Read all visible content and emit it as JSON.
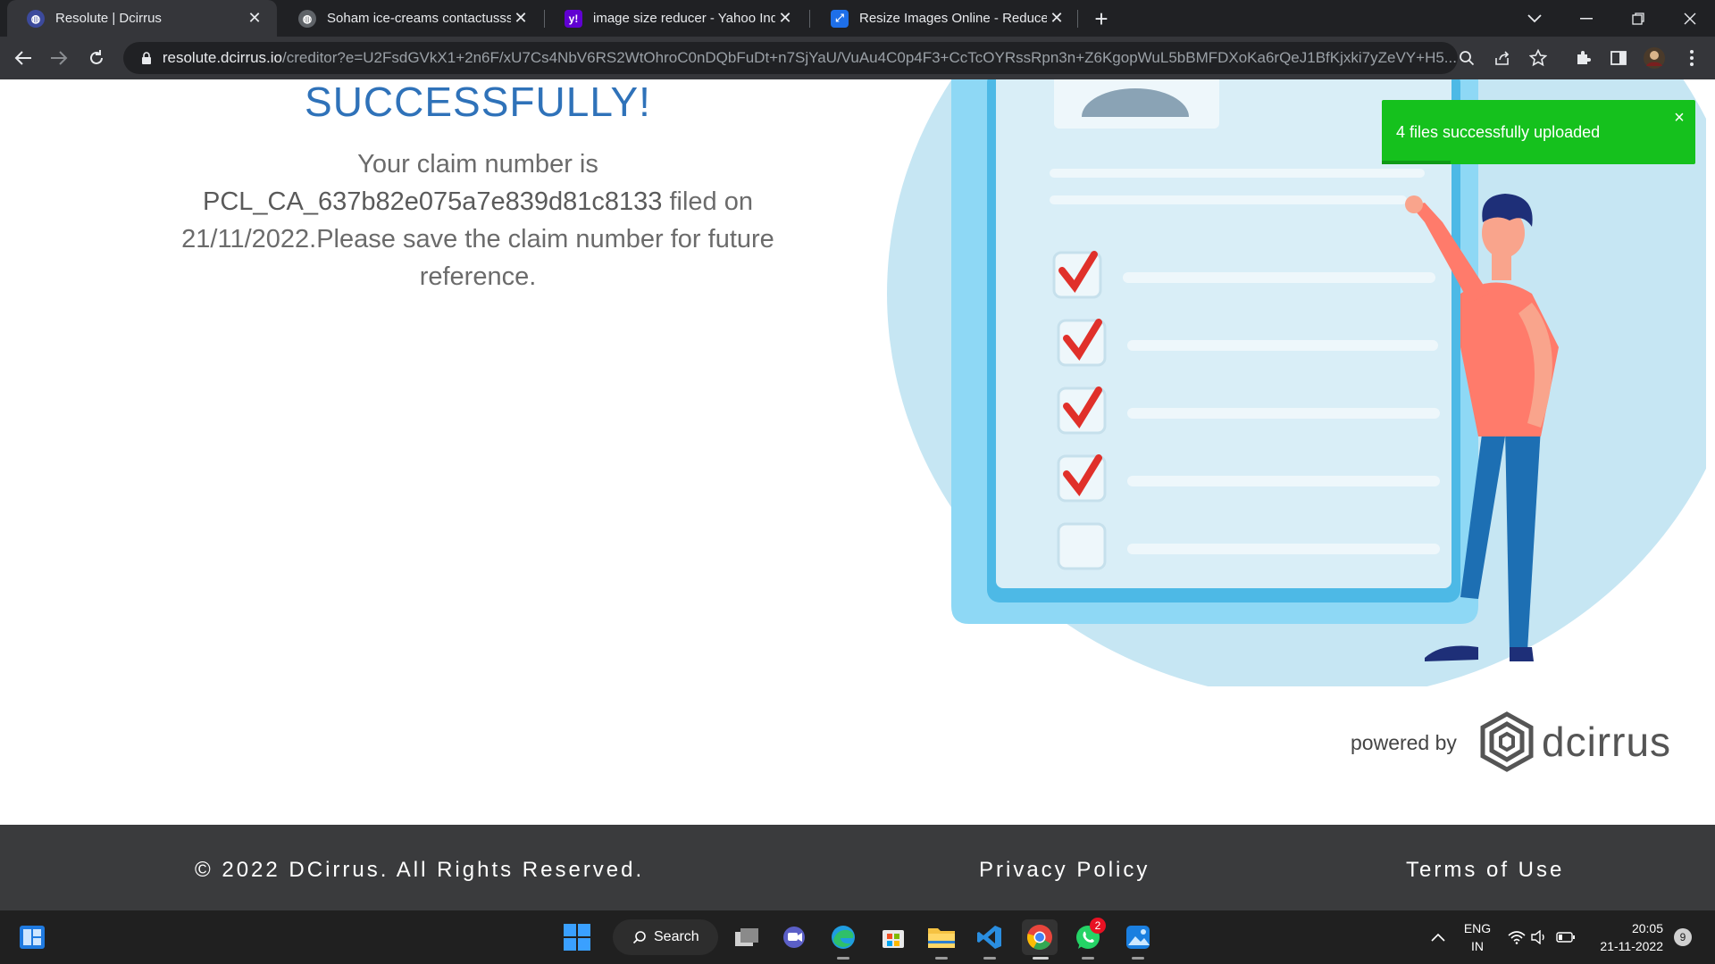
{
  "browser": {
    "tabs": [
      {
        "title": "Resolute | Dcirrus",
        "active": true,
        "favicon": "globe-blue-icon"
      },
      {
        "title": "Soham ice-creams contactusssss",
        "active": false,
        "favicon": "globe-icon"
      },
      {
        "title": "image size reducer - Yahoo India",
        "active": false,
        "favicon": "yahoo-icon",
        "favicon_text": "y!"
      },
      {
        "title": "Resize Images Online - Reduce JPG",
        "active": false,
        "favicon": "resize-icon"
      }
    ],
    "url_host": "resolute.dcirrus.io",
    "url_rest": "/creditor?e=U2FsdGVkX1+2n6F/xU7Cs4NbV6RS2WtOhroC0nDQbFuDt+n7SjYaU/VuAu4C0p4F3+CcTcOYRssRpn3n+Z6KgopWuL5bBMFDXoKa6rQeJ1BfKjxki7yZeVY+H5..."
  },
  "page": {
    "heading": "SUCCESSFULLY!",
    "message_line1": "Your claim number is",
    "claim_number": "PCL_CA_637b82e075a7e839d81c8133",
    "message_line2_suffix": "filed on",
    "message_line3": "21/11/2022.Please save the claim number for future",
    "message_line4": "reference.",
    "checklist": {
      "checked_count": 4,
      "total_count": 5
    }
  },
  "toast": {
    "message": "4 files successfully uploaded",
    "close_glyph": "×",
    "progress": 0.22
  },
  "branding": {
    "powered_by": "powered by",
    "brand_name": "dcirrus"
  },
  "footer": {
    "copyright": "© 2022 DCirrus.   All Rights Reserved.",
    "privacy": "Privacy Policy",
    "terms": "Terms of Use"
  },
  "taskbar": {
    "search_label": "Search",
    "whatsapp_badge": "2",
    "language_line1": "ENG",
    "language_line2": "IN",
    "time": "20:05",
    "date": "21-11-2022",
    "notification_count": "9"
  },
  "colors": {
    "heading": "#2f72b9",
    "toast": "#15c11d",
    "footer": "#3a3b3d",
    "checkmark": "#e0302a"
  }
}
